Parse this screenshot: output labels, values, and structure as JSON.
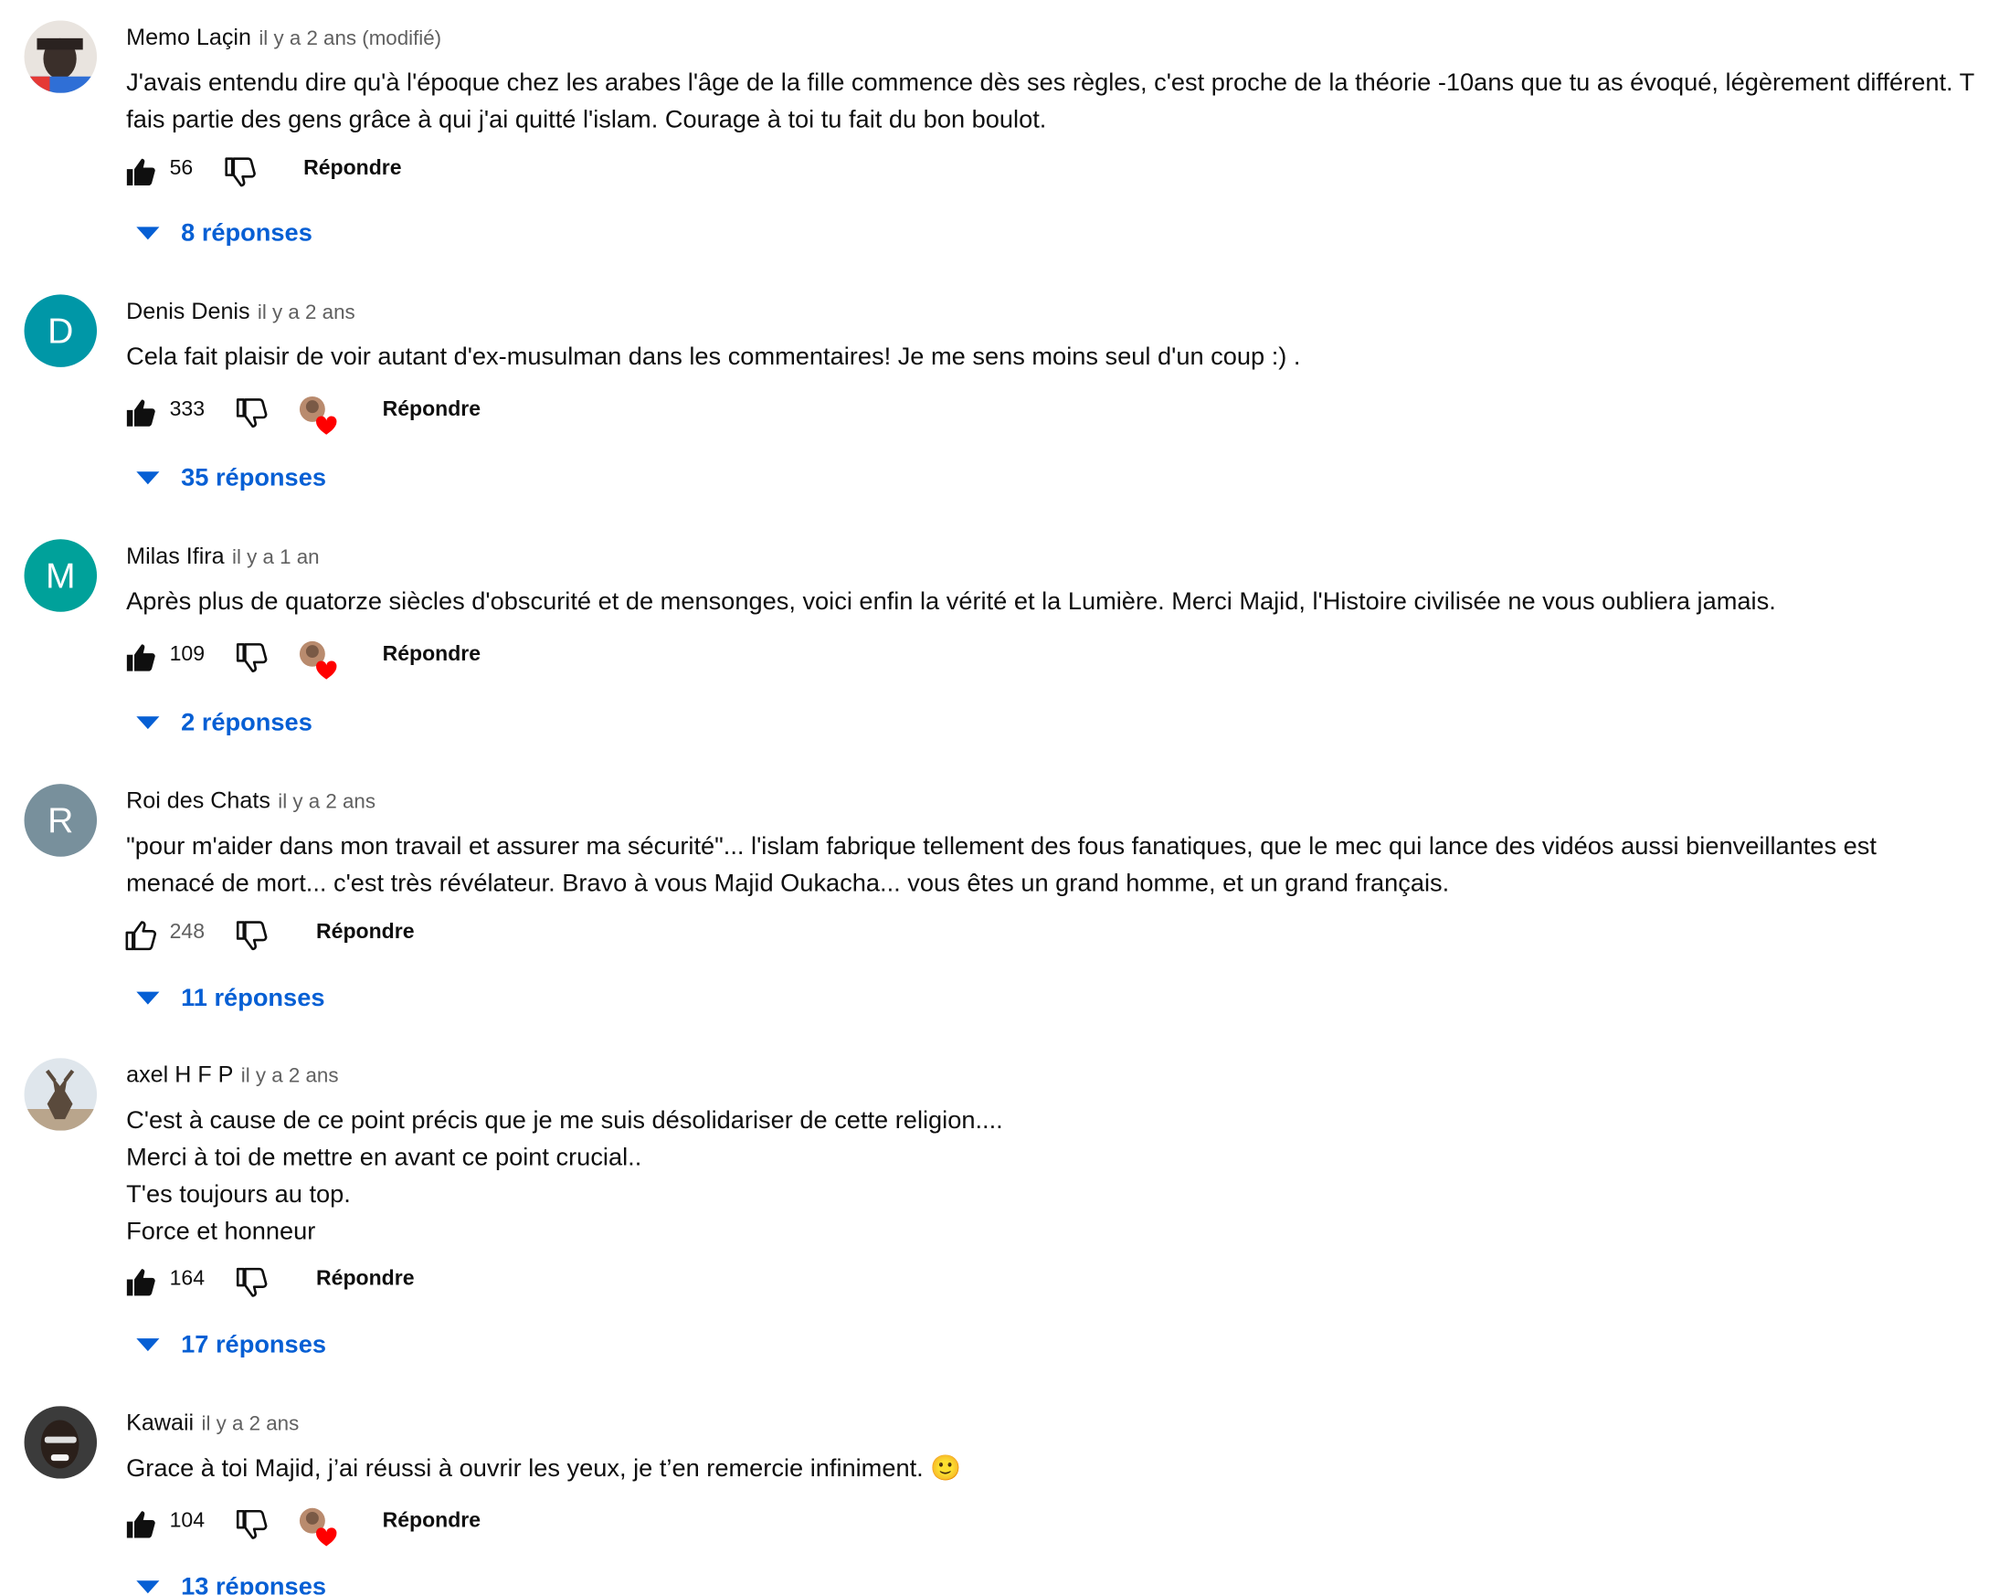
{
  "colors": {
    "link": "#065fd4",
    "meta_text": "#606060",
    "heart": "#ff0000"
  },
  "comments": [
    {
      "author": "Memo Laçin",
      "time": "il y a 2 ans (modifié)",
      "avatar_letter": "",
      "avatar_color": "#3a2f2a",
      "lines": [
        "J'avais entendu dire qu'à l'époque chez les arabes l'âge de la fille commence dès ses règles, c'est proche de la théorie -10ans que tu as évoqué, légèrement différent. T",
        "fais partie des gens grâce à qui j'ai quitté l'islam. Courage à toi tu fait du bon boulot."
      ],
      "likes": "56",
      "liked": true,
      "creator_heart": false,
      "reply_label": "Répondre",
      "replies_label": "8 réponses"
    },
    {
      "author": "Denis Denis",
      "time": "il y a 2 ans",
      "avatar_letter": "D",
      "avatar_color": "#0097a7",
      "lines": [
        "Cela fait plaisir de voir autant d'ex-musulman dans les commentaires! Je me sens moins seul d'un coup :) ."
      ],
      "likes": "333",
      "liked": true,
      "creator_heart": true,
      "reply_label": "Répondre",
      "replies_label": "35 réponses"
    },
    {
      "author": "Milas Ifira",
      "time": "il y a 1 an",
      "avatar_letter": "M",
      "avatar_color": "#00a19a",
      "lines": [
        "Après plus de quatorze siècles d'obscurité et de mensonges, voici enfin la vérité et la Lumière. Merci Majid, l'Histoire civilisée ne vous oubliera jamais."
      ],
      "likes": "109",
      "liked": true,
      "creator_heart": true,
      "reply_label": "Répondre",
      "replies_label": "2 réponses"
    },
    {
      "author": "Roi des Chats",
      "time": "il y a 2 ans",
      "avatar_letter": "R",
      "avatar_color": "#78909c",
      "lines": [
        "\"pour m'aider dans mon travail et assurer ma sécurité\"... l'islam fabrique tellement des fous fanatiques, que le mec qui lance des vidéos aussi bienveillantes est",
        "menacé de mort... c'est très révélateur. Bravo à vous Majid Oukacha... vous êtes un grand homme, et un grand français."
      ],
      "likes": "248",
      "liked": false,
      "creator_heart": false,
      "reply_label": "Répondre",
      "replies_label": "11 réponses"
    },
    {
      "author": "axel H F P",
      "time": "il y a 2 ans",
      "avatar_letter": "",
      "avatar_color": "#c9d3db",
      "lines": [
        "C'est à cause de ce point précis que je me suis désolidariser de cette religion....",
        "Merci à toi de mettre en avant ce point crucial..",
        "T'es toujours au top.",
        "Force et honneur"
      ],
      "likes": "164",
      "liked": true,
      "creator_heart": false,
      "reply_label": "Répondre",
      "replies_label": "17 réponses"
    },
    {
      "author": "Kawaii",
      "time": "il y a 2 ans",
      "avatar_letter": "",
      "avatar_color": "#2b2b2b",
      "lines": [
        "Grace à toi Majid, j’ai réussi à ouvrir les yeux, je t’en remercie infiniment. 🙂"
      ],
      "likes": "104",
      "liked": true,
      "creator_heart": true,
      "reply_label": "Répondre",
      "replies_label": "13 réponses"
    }
  ]
}
